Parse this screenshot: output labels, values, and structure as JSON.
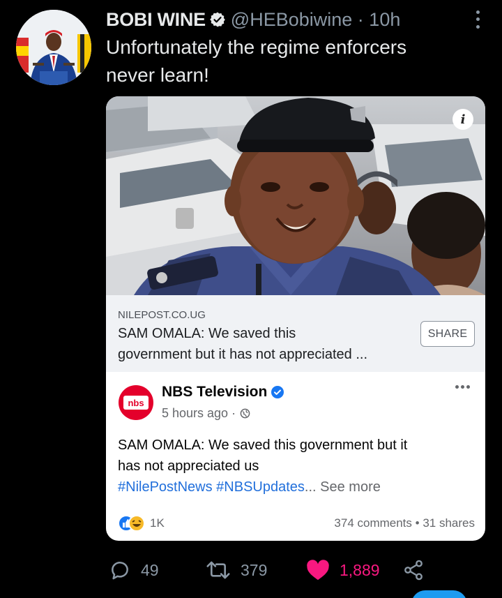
{
  "tweet": {
    "author_name": "BOBI WINE",
    "handle": "@HEBobiwine",
    "time": "10h",
    "text_line1": "Unfortunately the regime enforcers",
    "text_line2": "never learn!",
    "more_icon": "more-vertical-icon"
  },
  "link_card": {
    "domain": "NILEPOST.CO.UG",
    "title_line1": "SAM OMALA: We saved this",
    "title_line2": "government but it has not appreciated ...",
    "share_label": "SHARE",
    "info_icon": "i"
  },
  "fb_post": {
    "page_name": "NBS Television",
    "avatar_text": "nbs",
    "time": "5 hours ago",
    "body_line1": "SAM OMALA: We saved this government but it",
    "body_line2": "has not appreciated us",
    "hashtags": "#NilePostNews #NBSUpdates",
    "ellipsis": "...",
    "see_more": "See more",
    "reaction_count": "1K",
    "comments": "374 comments",
    "shares": "31 shares",
    "stats_sep": "•"
  },
  "actions": {
    "replies": "49",
    "retweets": "379",
    "likes": "1,889"
  },
  "colors": {
    "background": "#000000",
    "like": "#f91880",
    "link": "#216fdb",
    "verified": "#1d9bf0"
  }
}
